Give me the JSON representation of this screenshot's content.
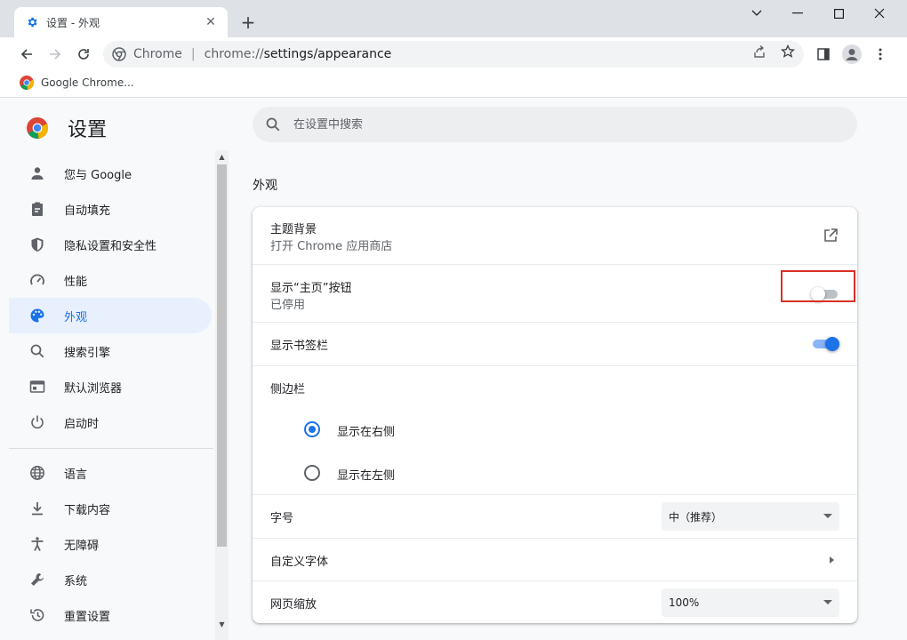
{
  "tab": {
    "title": "设置 - 外观",
    "close": "✕"
  },
  "window_controls": {
    "minimize": "—",
    "maximize": "☐",
    "close": "✕",
    "menu": "⌄"
  },
  "toolbar": {
    "site_label": "Chrome",
    "separator": "|",
    "url_scheme": "chrome://",
    "url_path": "settings/appearance"
  },
  "bookmarks": [
    {
      "label": "Google Chrome..."
    }
  ],
  "settings": {
    "brand": "设置",
    "search_placeholder": "在设置中搜索",
    "nav": [
      {
        "label": "您与 Google",
        "icon": "person-icon",
        "active": false
      },
      {
        "label": "自动填充",
        "icon": "clipboard-icon",
        "active": false
      },
      {
        "label": "隐私设置和安全性",
        "icon": "shield-icon",
        "active": false
      },
      {
        "label": "性能",
        "icon": "speedometer-icon",
        "active": false
      },
      {
        "label": "外观",
        "icon": "palette-icon",
        "active": true
      },
      {
        "label": "搜索引擎",
        "icon": "search-icon",
        "active": false
      },
      {
        "label": "默认浏览器",
        "icon": "browser-icon",
        "active": false
      },
      {
        "label": "启动时",
        "icon": "power-icon",
        "active": false
      },
      {
        "label": "语言",
        "icon": "globe-icon",
        "active": false
      },
      {
        "label": "下载内容",
        "icon": "download-icon",
        "active": false
      },
      {
        "label": "无障碍",
        "icon": "accessibility-icon",
        "active": false
      },
      {
        "label": "系统",
        "icon": "wrench-icon",
        "active": false
      },
      {
        "label": "重置设置",
        "icon": "history-icon",
        "active": false
      }
    ],
    "section_title": "外观",
    "theme": {
      "label": "主题背景",
      "sub": "打开 Chrome 应用商店"
    },
    "home_button": {
      "label": "显示“主页”按钮",
      "sub": "已停用",
      "enabled": false
    },
    "bookmarks_bar": {
      "label": "显示书签栏",
      "enabled": true
    },
    "side_panel": {
      "label": "侧边栏",
      "options": [
        {
          "label": "显示在右侧",
          "checked": true
        },
        {
          "label": "显示在左侧",
          "checked": false
        }
      ]
    },
    "font_size": {
      "label": "字号",
      "value": "中（推荐）"
    },
    "custom_fonts": {
      "label": "自定义字体"
    },
    "page_zoom": {
      "label": "网页缩放",
      "value": "100%"
    }
  },
  "colors": {
    "accent": "#1a73e8",
    "highlight": "#d93025"
  }
}
